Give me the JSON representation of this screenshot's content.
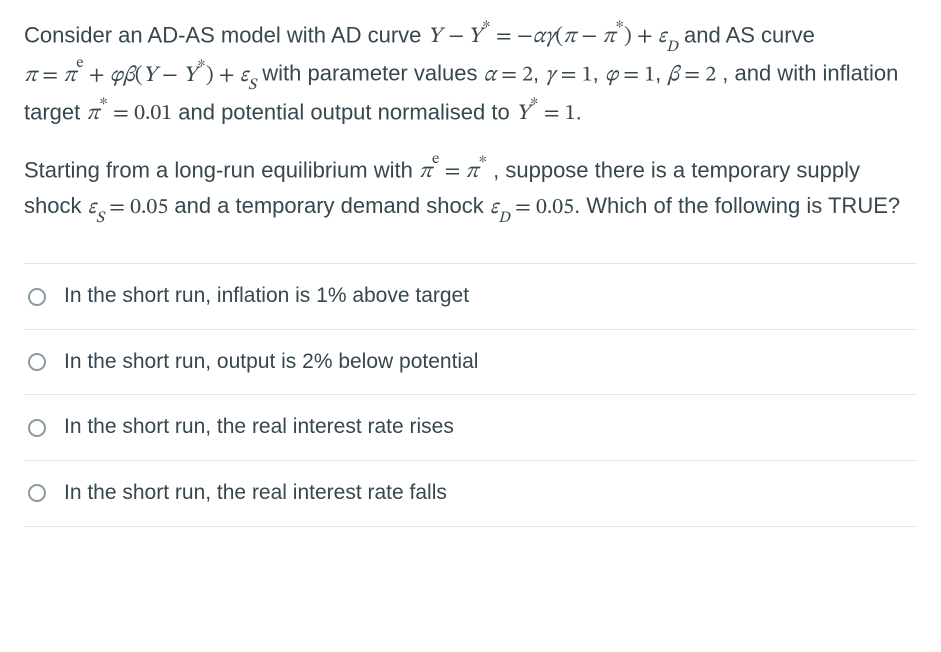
{
  "question": {
    "para1_pre": "Consider an AD-AS model with AD curve ",
    "para1_mid1": " and AS curve ",
    "para1_mid2": " with parameter values ",
    "para1_mid3": ", and with inflation target ",
    "para1_mid4": " and potential output normalised to ",
    "para1_end": ".",
    "para2_pre": "Starting from a long-run equilibrium with ",
    "para2_mid1": ", suppose there is a temporary supply shock ",
    "para2_mid2": " and a temporary demand shock ",
    "para2_end": ". Which of the following is TRUE?",
    "eq_ad": "Y − Y* = −αγ(π − π*) + ϵD",
    "eq_as": "π = πe + ϕβ(Y − Y*) + ϵS",
    "param_alpha": "α = 2",
    "param_gamma": "γ = 1",
    "param_phi": "ϕ = 1",
    "param_beta": "β = 2",
    "pi_target": "π* = 0.01",
    "ystar": "Y* = 1",
    "pie_eq": "πe = π*",
    "eps_s": "ϵS = 0.05",
    "eps_d": "ϵD = 0.05"
  },
  "options": [
    {
      "label": "In the short run, inflation is 1% above target"
    },
    {
      "label": "In the short run, output is 2% below potential"
    },
    {
      "label": "In the short run, the real interest rate rises"
    },
    {
      "label": "In the short run, the real interest rate falls"
    }
  ]
}
